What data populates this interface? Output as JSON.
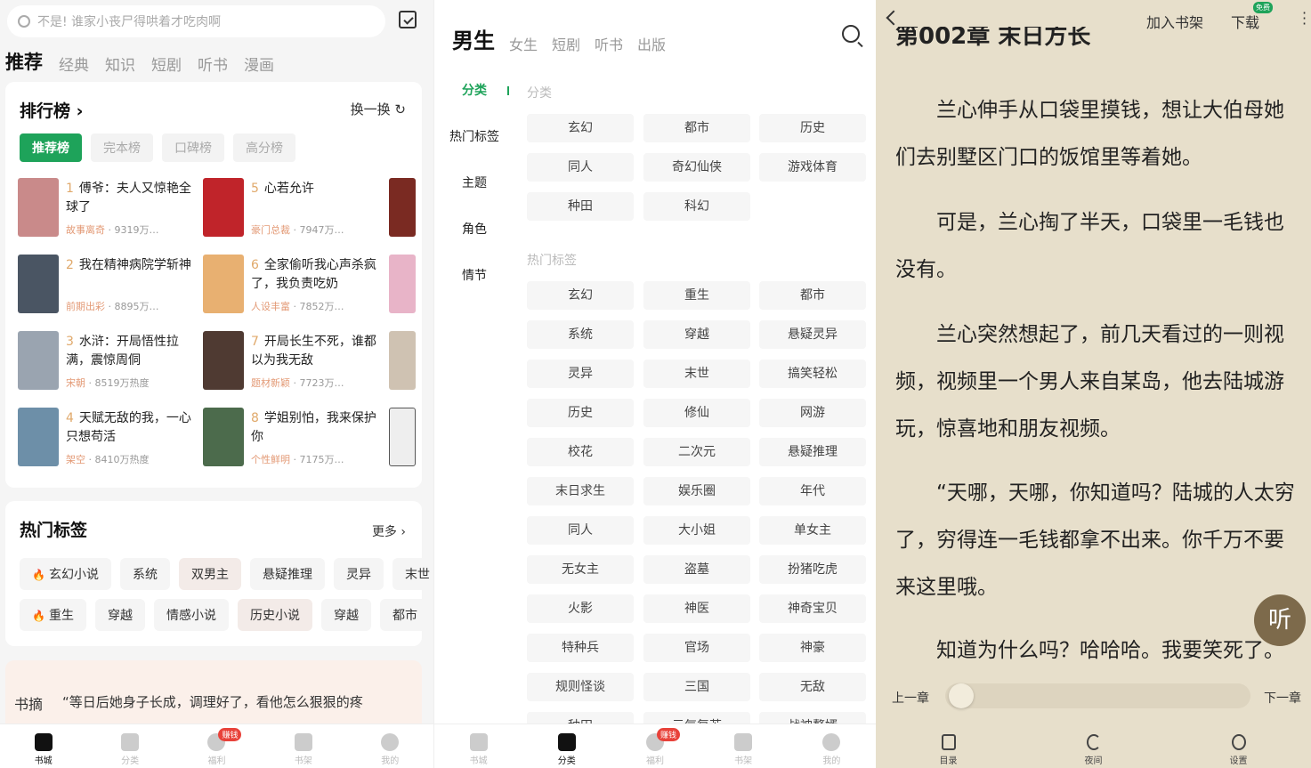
{
  "p1": {
    "search_placeholder": "不是! 谁家小丧尸得哄着才吃肉啊",
    "nav": [
      "推荐",
      "经典",
      "知识",
      "短剧",
      "听书",
      "漫画"
    ],
    "rank": {
      "title": "排行榜 ›",
      "swap": "换一换 ↻",
      "tabs": [
        "推荐榜",
        "完本榜",
        "口碑榜",
        "高分榜"
      ],
      "books": [
        {
          "rank": "1",
          "title": "傅爷：夫人又惊艳全球了",
          "tag": "故事离奇",
          "meta": " · 9319万…",
          "color": "#c98a8a"
        },
        {
          "rank": "2",
          "title": "我在精神病院学斩神",
          "tag": "前期出彩",
          "meta": " · 8895万…",
          "color": "#4a5563"
        },
        {
          "rank": "3",
          "title": "水浒：开局悟性拉满，震惊周侗",
          "tag": "宋朝",
          "meta": " · 8519万热度",
          "color": "#9aa4b0"
        },
        {
          "rank": "4",
          "title": "天赋无敌的我，一心只想苟活",
          "tag": "架空",
          "meta": " · 8410万热度",
          "color": "#6d8fa8"
        },
        {
          "rank": "5",
          "title": "心若允许",
          "tag": "豪门总裁",
          "meta": " · 7947万…",
          "color": "#c0242a"
        },
        {
          "rank": "6",
          "title": "全家偷听我心声杀疯了，我负责吃奶",
          "tag": "人设丰富",
          "meta": " · 7852万…",
          "color": "#e8b071"
        },
        {
          "rank": "7",
          "title": "开局长生不死，谁都以为我无敌",
          "tag": "题材新颖",
          "meta": " · 7723万…",
          "color": "#4f3a32"
        },
        {
          "rank": "8",
          "title": "学姐别怕，我来保护你",
          "tag": "个性鲜明",
          "meta": " · 7175万…",
          "color": "#4c6b4c"
        }
      ]
    },
    "tags": {
      "title": "热门标签",
      "more": "更多 ›",
      "row1": [
        "玄幻小说",
        "系统",
        "双男主",
        "悬疑推理",
        "灵异",
        "末世"
      ],
      "row2": [
        "重生",
        "穿越",
        "情感小说",
        "历史小说",
        "穿越",
        "都市"
      ]
    },
    "quote": {
      "label": "书摘",
      "text": "“等日后她身子长成，调理好了，看他怎么狠狠的疼"
    },
    "bottom": [
      "书城",
      "分类",
      "福利",
      "书架",
      "我的"
    ],
    "badge": "赚钱"
  },
  "p2": {
    "nav": [
      "男生",
      "女生",
      "短剧",
      "听书",
      "出版"
    ],
    "side": [
      "分类",
      "热门标签",
      "主题",
      "角色",
      "情节"
    ],
    "sec1": "分类",
    "sec2": "热门标签",
    "cats": [
      "玄幻",
      "都市",
      "历史",
      "同人",
      "奇幻仙侠",
      "游戏体育",
      "种田",
      "科幻"
    ],
    "hot": [
      "玄幻",
      "重生",
      "都市",
      "系统",
      "穿越",
      "悬疑灵异",
      "灵异",
      "末世",
      "搞笑轻松",
      "历史",
      "修仙",
      "网游",
      "校花",
      "二次元",
      "悬疑推理",
      "末日求生",
      "娱乐圈",
      "年代",
      "同人",
      "大小姐",
      "单女主",
      "无女主",
      "盗墓",
      "扮猪吃虎",
      "火影",
      "神医",
      "神奇宝贝",
      "特种兵",
      "官场",
      "神豪",
      "规则怪谈",
      "三国",
      "无敌",
      "种田",
      "元气复苏",
      "战神赘婿"
    ],
    "bottom": [
      "书城",
      "分类",
      "福利",
      "书架",
      "我的"
    ],
    "badge": "赚钱"
  },
  "p3": {
    "add_shelf": "加入书架",
    "download": "下载",
    "free": "免费",
    "chapter": "第002章 末日方长",
    "paras": [
      "兰心伸手从口袋里摸钱，想让大伯母她们去别墅区门口的饭馆里等着她。",
      "可是，兰心掏了半天，口袋里一毛钱也没有。",
      "兰心突然想起了，前几天看过的一则视频，视频里一个男人来自某岛，他去陆城游玩，惊喜地和朋友视频。",
      "“天哪，天哪，你知道吗？陆城的人太穷了，穷得连一毛钱都拿不出来。你千万不要来这里哦。",
      "知道为什么吗？哈哈哈。我要笑死了。"
    ],
    "listen": "听",
    "prev": "上一章",
    "next": "下一章",
    "progress": 0,
    "bottom": [
      "目录",
      "夜间",
      "设置"
    ]
  }
}
